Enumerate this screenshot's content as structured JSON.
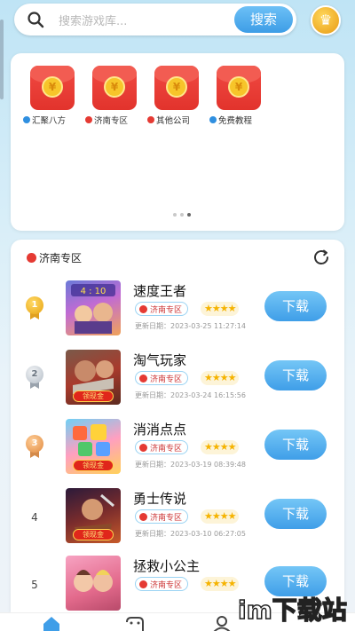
{
  "search": {
    "placeholder": "搜索游戏库...",
    "button_label": "搜索"
  },
  "banner": {
    "items": [
      {
        "label": "汇聚八方",
        "dot_color": "#2f8fe0"
      },
      {
        "label": "济南专区",
        "dot_color": "#e53a33"
      },
      {
        "label": "其他公司",
        "dot_color": "#e53a33"
      },
      {
        "label": "免费教程",
        "dot_color": "#2f8fe0"
      }
    ],
    "coin_glyph": "¥",
    "pager": {
      "count": 3,
      "active": 2
    }
  },
  "list": {
    "title": "济南专区",
    "title_dot_color": "#e53a33",
    "download_label": "下载",
    "games": [
      {
        "rank": "1",
        "name": "速度王者",
        "zone": "济南专区",
        "stars": "★★★★",
        "date": "更新日期：2023-03-25 11:27:14",
        "thumb_tag": ""
      },
      {
        "rank": "2",
        "name": "淘气玩家",
        "zone": "济南专区",
        "stars": "★★★★",
        "date": "更新日期：2023-03-24 16:15:56",
        "thumb_tag": "领现金"
      },
      {
        "rank": "3",
        "name": "消消点点",
        "zone": "济南专区",
        "stars": "★★★★",
        "date": "更新日期：2023-03-19 08:39:48",
        "thumb_tag": "领现金"
      },
      {
        "rank": "4",
        "name": "勇士传说",
        "zone": "济南专区",
        "stars": "★★★★",
        "date": "更新日期：2023-03-10 06:27:05",
        "thumb_tag": "领现金"
      },
      {
        "rank": "5",
        "name": "拯救小公主",
        "zone": "济南专区",
        "stars": "★★★★",
        "date": "",
        "thumb_tag": ""
      }
    ]
  },
  "watermark": "im下载站",
  "colors": {
    "accent": "#3f9ee8",
    "red": "#e53a33",
    "gold": "#f5b300"
  }
}
